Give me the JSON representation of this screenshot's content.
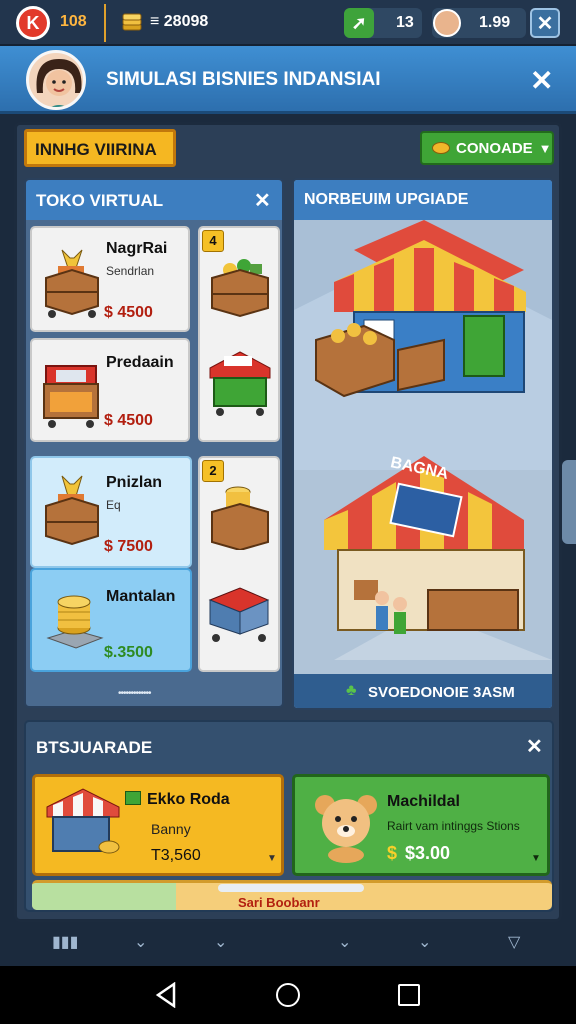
{
  "topbar": {
    "score": "108",
    "coins": "≡ 28098",
    "level": "13",
    "gems": "1.99"
  },
  "header": {
    "title": "SIMULASI BISNIES INDANSIAI"
  },
  "banner": {
    "label": "INNHG VIIRINA",
    "button_label": "CONOADE"
  },
  "left_panel": {
    "title": "TOKO VIRTUAL",
    "items": [
      {
        "name": "NagrRai",
        "subtitle": "Sendrlan",
        "price": "$ 4500"
      },
      {
        "name": "Predaain",
        "subtitle": "",
        "price": "$ 4500"
      },
      {
        "name": "Pnizlan",
        "subtitle": "Eq",
        "price": "$ 7500"
      },
      {
        "name": "Mantalan",
        "subtitle": "",
        "price": "$.3500"
      }
    ],
    "badges": [
      "4",
      "2"
    ],
    "pager": "•••••••••••••"
  },
  "right_panel": {
    "title": "NORBEUIM UPGIADE",
    "shop_sign": "BAGNA",
    "footer": "SVOEDONOIE 3ASM"
  },
  "bottom_panel": {
    "title": "BTSJUARADE",
    "cards": [
      {
        "title": "Ekko Roda",
        "line2": "Banny",
        "price": "T3,560"
      },
      {
        "title": "Machildal",
        "line2": "Rairt vam intinggs Stions",
        "price": "$3.00"
      }
    ],
    "strip_text": "Sari Boobanr"
  },
  "colors": {
    "header_blue": "#3f8fd3",
    "panel": "#2c3f57",
    "banner_yellow": "#f5b722",
    "button_green": "#3fa536",
    "price_red": "#b21f10",
    "price_green": "#2e8b22"
  },
  "icons": [
    "brand-k-icon",
    "coin-stack-icon",
    "level-arrow-icon",
    "avatar-icon",
    "close-icon",
    "coin-icon",
    "chevron-down-icon",
    "clover-icon",
    "back-icon",
    "home-icon",
    "recents-icon"
  ]
}
